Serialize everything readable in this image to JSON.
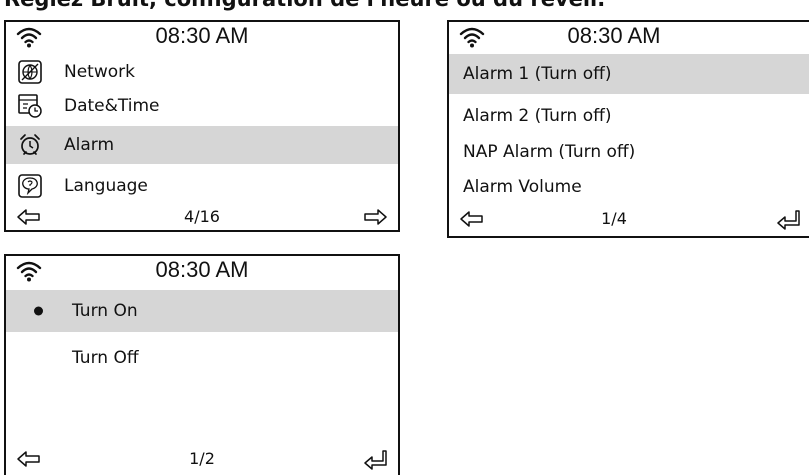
{
  "caption": "Réglez Bruit, configuration de l'heure ou du réveil.",
  "screens": {
    "settings": {
      "time": "08:30 AM",
      "items": [
        {
          "label": "Network",
          "icon": "network-icon"
        },
        {
          "label": "Date&Time",
          "icon": "calendar-clock-icon"
        },
        {
          "label": "Alarm",
          "icon": "alarm-clock-icon",
          "selected": true
        },
        {
          "label": "Language",
          "icon": "speech-bubble-icon"
        }
      ],
      "page": "4/16",
      "left_nav": "back-arrow-icon",
      "right_nav": "forward-arrow-icon"
    },
    "alarm": {
      "time": "08:30 AM",
      "items": [
        {
          "label": "Alarm 1 (Turn off)",
          "selected": true
        },
        {
          "label": "Alarm 2 (Turn off)"
        },
        {
          "label": "NAP Alarm (Turn off)"
        },
        {
          "label": "Alarm Volume"
        }
      ],
      "page": "1/4",
      "left_nav": "back-arrow-icon",
      "right_nav": "enter-icon"
    },
    "turn": {
      "time": "08:30 AM",
      "items": [
        {
          "label": "Turn On",
          "selected": true,
          "checked": true
        },
        {
          "label": "Turn Off"
        }
      ],
      "page": "1/2",
      "left_nav": "back-arrow-icon",
      "right_nav": "enter-icon"
    }
  },
  "colors": {
    "selection": "#d6d6d6",
    "border": "#111111"
  }
}
